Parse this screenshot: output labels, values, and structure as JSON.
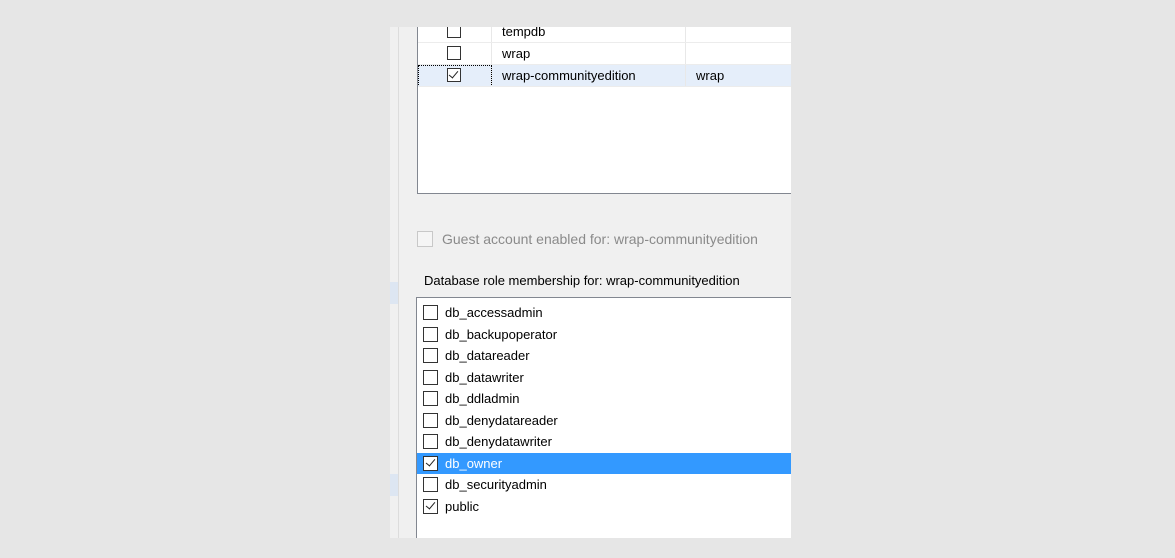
{
  "user_mapping": {
    "rows": [
      {
        "checked": false,
        "database": "tempdb",
        "user": ""
      },
      {
        "checked": false,
        "database": "wrap",
        "user": ""
      },
      {
        "checked": true,
        "database": "wrap-communityedition",
        "user": "wrap",
        "selected": true
      }
    ]
  },
  "guest_account": {
    "label": "Guest account enabled for: wrap-communityedition",
    "checked": false,
    "enabled": false
  },
  "role_membership": {
    "title": "Database role membership for: wrap-communityedition",
    "roles": [
      {
        "name": "db_accessadmin",
        "checked": false
      },
      {
        "name": "db_backupoperator",
        "checked": false
      },
      {
        "name": "db_datareader",
        "checked": false
      },
      {
        "name": "db_datawriter",
        "checked": false
      },
      {
        "name": "db_ddladmin",
        "checked": false
      },
      {
        "name": "db_denydatareader",
        "checked": false
      },
      {
        "name": "db_denydatawriter",
        "checked": false
      },
      {
        "name": "db_owner",
        "checked": true,
        "selected": true
      },
      {
        "name": "db_securityadmin",
        "checked": false
      },
      {
        "name": "public",
        "checked": true
      }
    ]
  },
  "colors": {
    "selection": "#3399ff",
    "grid_selection": "#e5eefa",
    "background": "#e6e6e6"
  }
}
